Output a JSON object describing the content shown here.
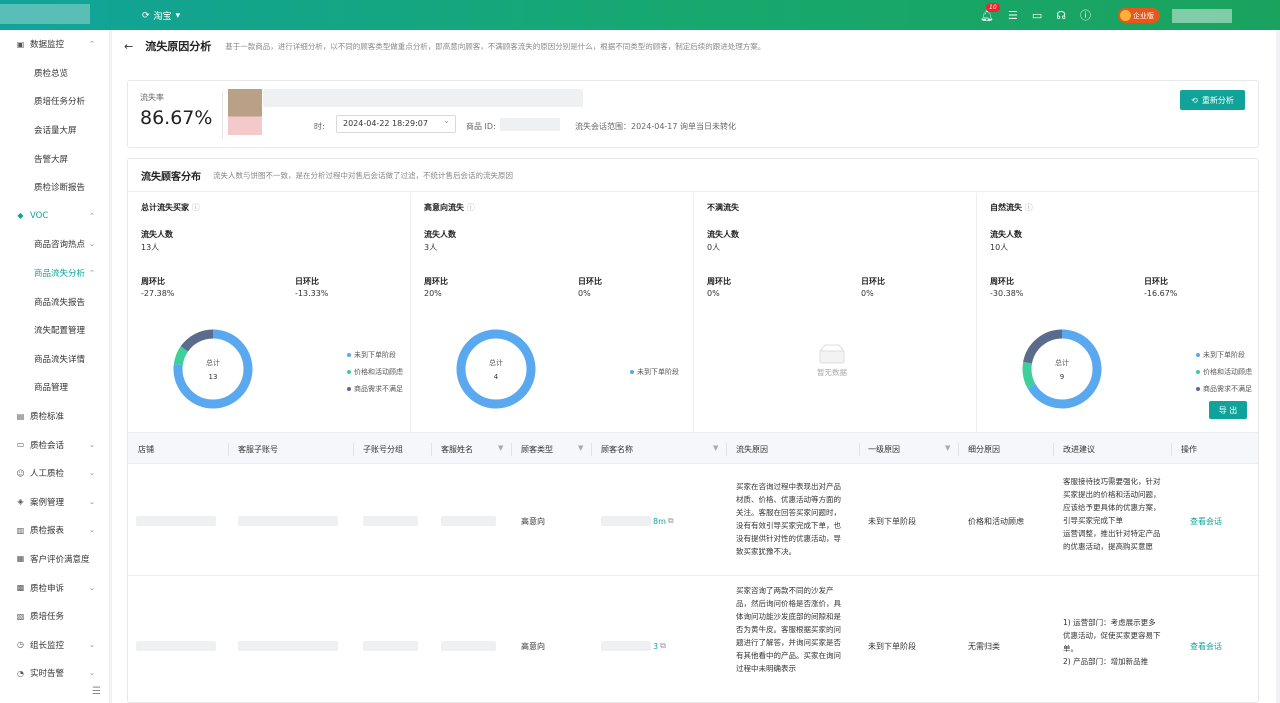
{
  "topbar": {
    "store": "淘宝",
    "badge_count": "10",
    "enterprise": "企业版"
  },
  "sidebar": {
    "items": [
      {
        "label": "数据监控",
        "level": 1,
        "icon": "▣",
        "chevron": "⌃",
        "active": false
      },
      {
        "label": "质检总览",
        "level": 2,
        "active": false
      },
      {
        "label": "质培任务分析",
        "level": 2,
        "active": false
      },
      {
        "label": "会话量大屏",
        "level": 2,
        "active": false
      },
      {
        "label": "告警大屏",
        "level": 2,
        "active": false
      },
      {
        "label": "质检诊断报告",
        "level": 2,
        "active": false
      },
      {
        "label": "VOC",
        "level": 1,
        "icon": "◆",
        "chevron": "⌃",
        "active": true
      },
      {
        "label": "商品咨询热点",
        "level": 2,
        "chevron": "⌄",
        "active": false
      },
      {
        "label": "商品流失分析",
        "level": 2,
        "chevron": "⌃",
        "active": true
      },
      {
        "label": "商品流失报告",
        "level": 2,
        "active": false
      },
      {
        "label": "流失配置管理",
        "level": 2,
        "active": false
      },
      {
        "label": "商品流失详情",
        "level": 2,
        "active": false
      },
      {
        "label": "商品管理",
        "level": 2,
        "active": false
      },
      {
        "label": "质检标准",
        "level": 1,
        "icon": "▤",
        "active": false
      },
      {
        "label": "质检会话",
        "level": 1,
        "icon": "▭",
        "chevron": "⌄",
        "active": false
      },
      {
        "label": "人工质检",
        "level": 1,
        "icon": "☺",
        "chevron": "⌄",
        "active": false
      },
      {
        "label": "案例管理",
        "level": 1,
        "icon": "◈",
        "chevron": "⌄",
        "active": false
      },
      {
        "label": "质检报表",
        "level": 1,
        "icon": "▥",
        "chevron": "⌄",
        "active": false
      },
      {
        "label": "客户评价满意度",
        "level": 1,
        "icon": "▦",
        "active": false
      },
      {
        "label": "质检申诉",
        "level": 1,
        "icon": "▩",
        "chevron": "⌄",
        "active": false
      },
      {
        "label": "质培任务",
        "level": 1,
        "icon": "▧",
        "active": false
      },
      {
        "label": "组长监控",
        "level": 1,
        "icon": "◷",
        "chevron": "⌄",
        "active": false
      },
      {
        "label": "实时告警",
        "level": 1,
        "icon": "◔",
        "chevron": "⌄",
        "active": false
      }
    ]
  },
  "header": {
    "back": "←",
    "title": "流失原因分析",
    "desc": "基于一款商品，进行详细分析，以不同的顾客类型做重点分析，即高意向顾客，不满顾客流失的原因分别是什么，根据不同类型的顾客，制定后续的跟进处理方案。"
  },
  "summary": {
    "rate_label": "流失率",
    "rate": "86.67%",
    "date_label": "时:",
    "date_value": "2024-04-22 18:29:07",
    "goods_id_label": "商品 ID:",
    "range": "流失会话范围：2024-04-17  询单当日未转化",
    "reanalyze": "重新分析"
  },
  "dist": {
    "title": "流失顾客分布",
    "desc": "流失人数与饼图不一致，是在分析过程中对售后会话做了过滤，不统计售后会话的流失原因",
    "export": "导 出",
    "legend_colors": [
      "#5aa8f0",
      "#3ecf9a",
      "#5a6b8c"
    ],
    "columns": [
      {
        "title": "总计流失买家",
        "info": "ⓘ",
        "count_label": "流失人数",
        "count": "13人",
        "week_label": "周环比",
        "week": "-27.38%",
        "day_label": "日环比",
        "day": "-13.33%",
        "total_label": "总计",
        "total": "13",
        "segments": [
          10,
          1,
          2
        ],
        "legend": [
          "未到下单阶段",
          "价格和活动顾虑",
          "商品需求不满足"
        ]
      },
      {
        "title": "高意向流失",
        "info": "ⓘ",
        "count_label": "流失人数",
        "count": "3人",
        "week_label": "周环比",
        "week": "20%",
        "day_label": "日环比",
        "day": "0%",
        "total_label": "总计",
        "total": "4",
        "segments": [
          4
        ],
        "legend": [
          "未到下单阶段"
        ]
      },
      {
        "title": "不满流失",
        "info": "",
        "count_label": "流失人数",
        "count": "0人",
        "week_label": "周环比",
        "week": "0%",
        "day_label": "日环比",
        "day": "0%",
        "empty": "暂无数据"
      },
      {
        "title": "自然流失",
        "info": "ⓘ",
        "count_label": "流失人数",
        "count": "10人",
        "week_label": "周环比",
        "week": "-30.38%",
        "day_label": "日环比",
        "day": "-16.67%",
        "total_label": "总计",
        "total": "9",
        "segments": [
          6,
          1,
          2
        ],
        "legend": [
          "未到下单阶段",
          "价格和活动顾虑",
          "商品需求不满足"
        ]
      }
    ]
  },
  "table": {
    "headers": [
      "店铺",
      "客服子账号",
      "子账号分组",
      "客服姓名",
      "顾客类型",
      "顾客名称",
      "流失原因",
      "一级原因",
      "细分原因",
      "改进建议",
      "操作"
    ],
    "rows": [
      {
        "type": "高意向",
        "name_tail": "8m",
        "reason": "买家在咨询过程中表现出对产品材质、价格、优惠活动等方面的关注。客服在回答买家问题时，没有有效引导买家完成下单，也没有提供针对性的优惠活动，导致买家犹豫不决。",
        "level1": "未到下单阶段",
        "detail": "价格和活动顾虑",
        "suggest": "客服接待技巧需要强化，针对买家提出的价格和活动问题，应该给予更具体的优惠方案，引导买家完成下单\n运营调整，推出针对特定产品的优惠活动，提高购买意愿",
        "action": "查看会话"
      },
      {
        "type": "高意向",
        "name_tail": "3",
        "reason": "买家咨询了两款不同的沙发产品，然后询问价格是否涨价，具体询问功能沙发底部的间隙和是否为黄牛皮。客服根据买家的问题进行了解答，并询问买家是否有其他看中的产品。买家在询问过程中未明确表示",
        "level1": "未到下单阶段",
        "detail": "无需归类",
        "suggest": "1) 运营部门：考虑展示更多优惠活动，促使买家更容易下单。\n2) 产品部门：增加新品推",
        "action": "查看会话"
      }
    ]
  }
}
